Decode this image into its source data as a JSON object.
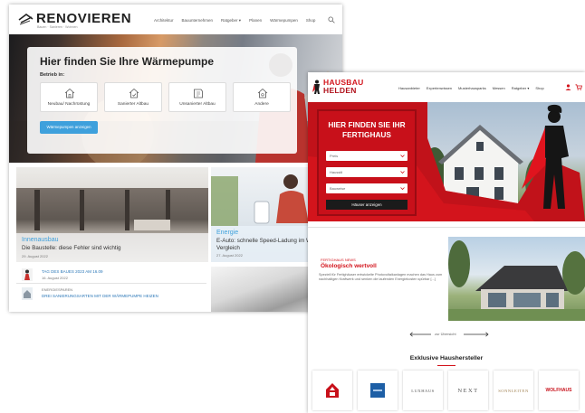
{
  "renovieren": {
    "logo": "RENOVIEREN",
    "tagline": "Bauen · Sanieren · Wohnen",
    "nav": [
      "Architektur",
      "Bauunternehmen",
      "Ratgeber ▾",
      "Planen",
      "Wärmepumpen",
      "Shop"
    ],
    "finder": {
      "title": "Hier finden Sie Ihre Wärmepumpe",
      "subtitle": "Betrieb in:",
      "options": [
        "Neubau/ Nachrüstung",
        "Sanierter Altbau",
        "Unsanierter Altbau",
        "Andere"
      ],
      "button": "Wärmepumpen anzeigen"
    },
    "cards": [
      {
        "category": "Innenausbau",
        "title": "Die Baustelle: diese Fehler sind wichtig",
        "date": "29. August 2022"
      },
      {
        "category": "Energie",
        "title": "E-Auto: schnelle Speed-Ladung im Wallbox Vergleich",
        "date": "27. August 2022"
      }
    ],
    "list": [
      {
        "title": "TAG DES BAUES 2023 AM 16.09",
        "date": "16. August 2022"
      },
      {
        "kicker": "ENERGIESPAREN",
        "title": "DREI SANIERUNGSARTEN MIT DER WÄRMEPUMPE HEIZEN"
      }
    ]
  },
  "hausbau": {
    "logo_line1": "HAUSBAU",
    "logo_line2": "HELDEN",
    "nav": [
      "Hausanbieter",
      "Expertenwissen",
      "Musterhausparks",
      "Messen",
      "Ratgeber ▾",
      "Shop"
    ],
    "finder": {
      "title_line1": "HIER FINDEN SIE IHR",
      "title_line2": "FERTIGHAUS",
      "selects": [
        "Preis",
        "Hausstil",
        "Bauweise"
      ],
      "button": "Häuser anzeigen"
    },
    "article": {
      "kicker": "FERTIGHAUS NEWS",
      "title": "Ökologisch wertvoll",
      "body": "Speziell für Fertighäuser entwickelte Photovoltaikanlagen machen das Haus zum nachhaltigen Kraftwerk und senken die laufenden Energiekosten spürbar [...]"
    },
    "pagination": "zur Übersicht",
    "manufacturers": {
      "heading": "Exklusive Haushersteller",
      "logos": [
        {
          "icon": "red-house-logo"
        },
        {
          "icon": "blue-square-logo"
        },
        {
          "text": "LUXHAUS"
        },
        {
          "text": "NEXT"
        },
        {
          "text": "SONNLEITEN"
        },
        {
          "text": "WOLFHAUS"
        }
      ]
    }
  },
  "colors": {
    "renovieren_accent": "#3ea0dc",
    "hausbau_red": "#d3141c",
    "hausbau_button": "#1b1b1b"
  }
}
